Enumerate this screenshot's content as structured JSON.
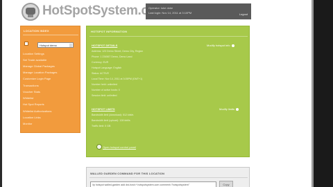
{
  "header": {
    "logo_text": "HotSpotSystem.com",
    "operator_line": "Operator: luke doke",
    "last_login": "Last login: Nov 14, 2011 at 3:10PM",
    "logout_label": "Logout"
  },
  "sidebar": {
    "title": "LOCATION INDEX",
    "selected_location": "Hotspot demo",
    "items": [
      "Location Settings",
      "Set Trade available",
      "Manage Global Packages",
      "Manage Location Packages",
      "Customize Login Page",
      "Transactions",
      "Voucher Stats",
      "Whitelist",
      "Hot Spot Reports",
      "Whitelist Authorizations",
      "Location Links",
      "Monitor"
    ]
  },
  "main": {
    "title": "HOTSPOT INFORMATION",
    "section1": {
      "head": "HOTSPOT DETAILS",
      "link": "Modify hotspot info",
      "lines": [
        "Address: 123 Demo Street, Demo City, Region",
        "Phone: 1 234567 Demo, Demo Land",
        "Currency: EUR",
        "Hotspot Language: English",
        "Status: ACTIVE",
        "Local Time: Nov 14, 2011 at 3:05PM (GMT+1)",
        "Number held: unlimited",
        "Number of active hosts: 0",
        "Session limit: unlimited"
      ]
    },
    "section2": {
      "head": "HOTSPOT LIMITS",
      "link": "Modify limits",
      "lines": [
        "Bandwidth limit (download): 512 kbit/s",
        "Bandwidth limit (upload): 128 kbit/s",
        "Traffic limit: 0 GB"
      ]
    },
    "go_label": "Open hotspot control panel"
  },
  "bottom": {
    "title": "WALLED GARDEN COMMAND FOR THIS LOCATION",
    "command": "/ip hotspot walled-garden add dst-host=*.hotspotsystem.com comment=\"hotspotsystem\"",
    "copy_label": "Copy"
  }
}
